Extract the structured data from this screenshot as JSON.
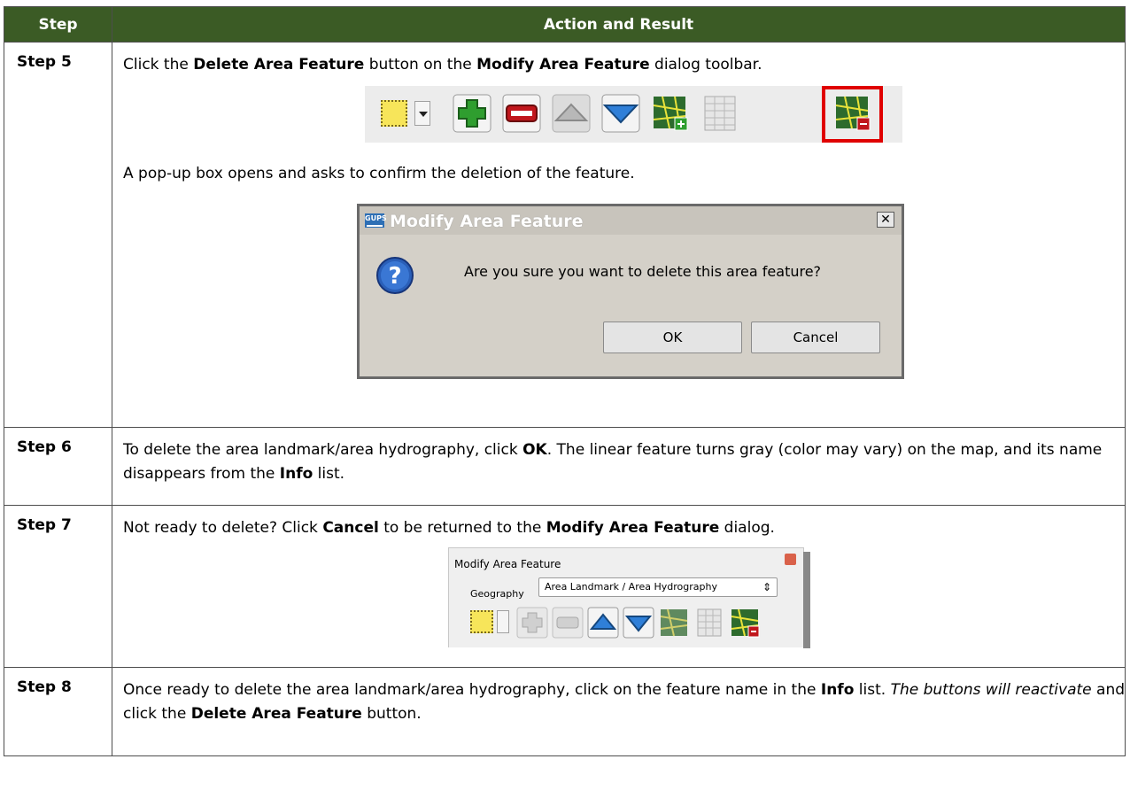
{
  "header": {
    "col_step": "Step",
    "col_action": "Action and Result"
  },
  "rows": [
    {
      "step": "Step 5",
      "line1": {
        "a": "Click the ",
        "b1": "Delete Area Feature",
        "c": " button on the ",
        "b2": "Modify Area Feature",
        "d": " dialog toolbar."
      },
      "line2": "A pop-up box opens and asks to confirm the deletion of the feature."
    },
    {
      "step": "Step 6",
      "text": {
        "a": "To delete the area landmark/area hydrography, click ",
        "b1": "OK",
        "c": ". The linear feature turns gray (color may vary) on the map, and its name disappears from the ",
        "b2": "Info",
        "d": " list."
      }
    },
    {
      "step": "Step 7",
      "text": {
        "a": "Not ready to delete? Click ",
        "b1": "Cancel",
        "c": " to be returned to the ",
        "b2": "Modify Area Feature",
        "d": " dialog."
      }
    },
    {
      "step": "Step 8",
      "text": {
        "a": "Once ready to delete the area landmark/area hydrography, click on the feature name in the ",
        "b1": "Info",
        "c": " list. ",
        "i1": "The buttons will reactivate",
        "d": " and click the ",
        "b2": "Delete Area Feature",
        "e": " button."
      }
    }
  ],
  "dialog": {
    "logo_text": "GUPS",
    "title": "Modify Area Feature",
    "close_glyph": "✕",
    "message": "Are you sure you want to delete this area feature?",
    "ok_label": "OK",
    "cancel_label": "Cancel"
  },
  "mini_dialog": {
    "title": "Modify Area Feature",
    "geography_label": "Geography",
    "geography_value": "Area Landmark / Area Hydrography",
    "select_arrows": "⇕"
  },
  "icons": {
    "toolbar": [
      "select-icon",
      "dropdown-arrow-icon",
      "add-icon",
      "delete-icon",
      "move-up-icon",
      "move-down-icon",
      "add-area-feature-icon",
      "attribute-table-icon",
      "delete-area-feature-icon"
    ],
    "question": "question-icon"
  },
  "colors": {
    "header_bg": "#3b5b25",
    "highlight": "#e00000",
    "add_green": "#2f9e2f",
    "delete_red": "#c0161c",
    "arrow_blue": "#2f7fd8"
  }
}
